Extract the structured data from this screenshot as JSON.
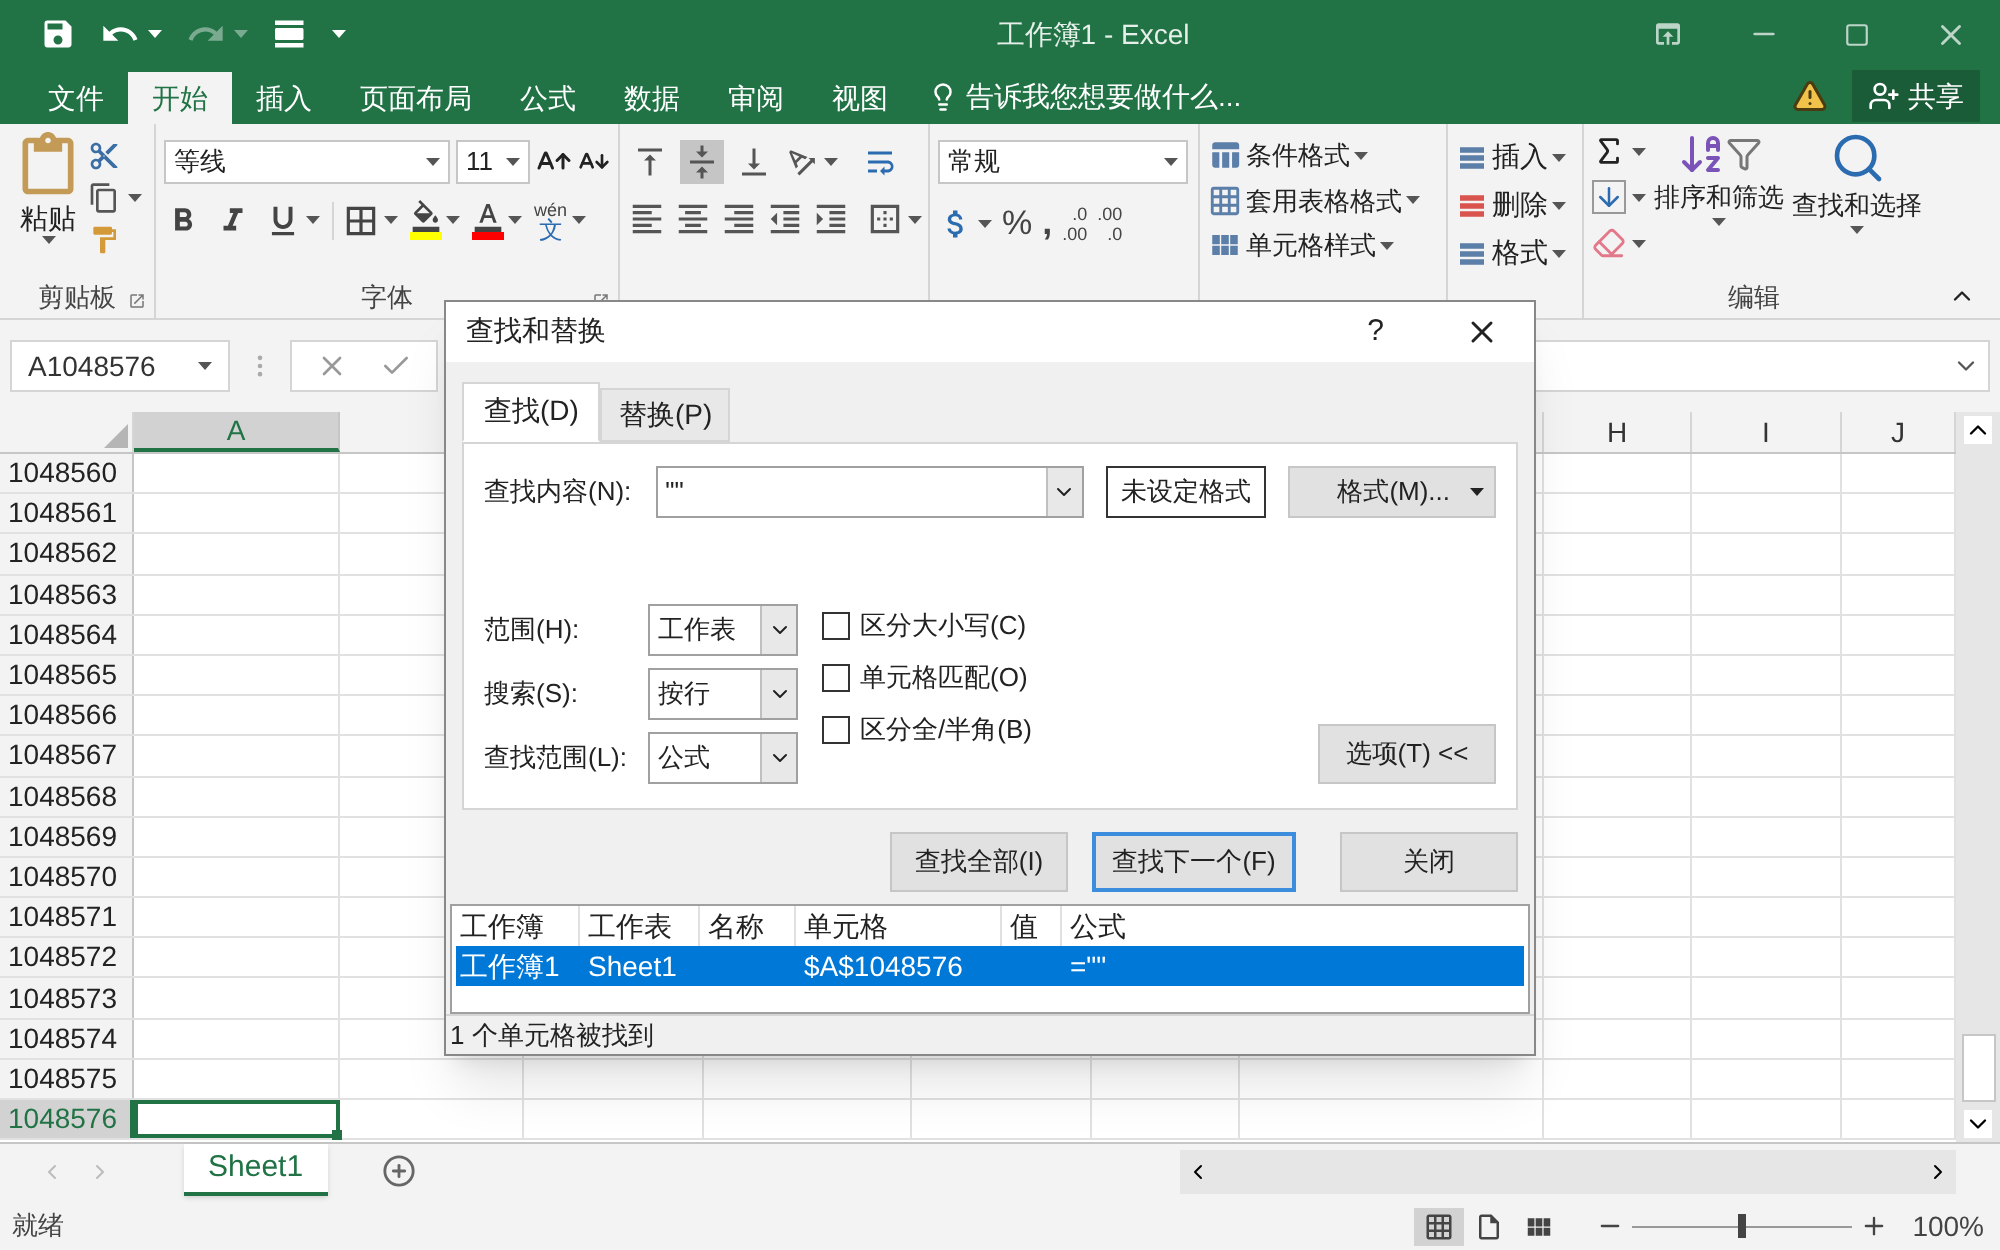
{
  "title_bar": {
    "title": "工作簿1 - Excel"
  },
  "ribbon_tabs": [
    {
      "label": "文件",
      "selected": false
    },
    {
      "label": "开始",
      "selected": true
    },
    {
      "label": "插入",
      "selected": false
    },
    {
      "label": "页面布局",
      "selected": false
    },
    {
      "label": "公式",
      "selected": false
    },
    {
      "label": "数据",
      "selected": false
    },
    {
      "label": "审阅",
      "selected": false
    },
    {
      "label": "视图",
      "selected": false
    }
  ],
  "tell_me": "告诉我您想要做什么...",
  "share_button": "共享",
  "ribbon": {
    "paste_label": "粘贴",
    "clipboard_label": "剪贴板",
    "font_name": "等线",
    "font_size": "11",
    "phonetic": {
      "top": "wén",
      "bottom": "文"
    },
    "font_label": "字体",
    "vertical_align": [
      {
        "selected": false
      },
      {
        "selected": true
      },
      {
        "selected": false
      }
    ],
    "number_format": "常规",
    "percent": "%",
    "comma": ",",
    "decimals": [
      {
        "top": ".0",
        "bottom": ".00"
      },
      {
        "top": ".00",
        "bottom": ".0"
      }
    ],
    "style_commands": [
      "条件格式",
      "套用表格格式",
      "单元格样式"
    ],
    "cell_commands": [
      "插入",
      "删除",
      "格式"
    ],
    "sort_filter": "排序和筛选",
    "find_select": "查找和选择",
    "editing_label": "编辑"
  },
  "name_box": "A1048576",
  "sheet": {
    "columns": [
      {
        "label": "A",
        "selected": true
      },
      {
        "label": "H",
        "selected": false
      },
      {
        "label": "I",
        "selected": false
      },
      {
        "label": "J",
        "selected": false
      }
    ],
    "rows": [
      {
        "label": "1048560",
        "selected": false
      },
      {
        "label": "1048561",
        "selected": false
      },
      {
        "label": "1048562",
        "selected": false
      },
      {
        "label": "1048563",
        "selected": false
      },
      {
        "label": "1048564",
        "selected": false
      },
      {
        "label": "1048565",
        "selected": false
      },
      {
        "label": "1048566",
        "selected": false
      },
      {
        "label": "1048567",
        "selected": false
      },
      {
        "label": "1048568",
        "selected": false
      },
      {
        "label": "1048569",
        "selected": false
      },
      {
        "label": "1048570",
        "selected": false
      },
      {
        "label": "1048571",
        "selected": false
      },
      {
        "label": "1048572",
        "selected": false
      },
      {
        "label": "1048573",
        "selected": false
      },
      {
        "label": "1048574",
        "selected": false
      },
      {
        "label": "1048575",
        "selected": false
      },
      {
        "label": "1048576",
        "selected": true
      }
    ]
  },
  "sheet_tabs": [
    {
      "label": "Sheet1",
      "selected": true
    }
  ],
  "status_bar": {
    "status": "就绪",
    "views": [
      {
        "selected": true
      },
      {
        "selected": false
      },
      {
        "selected": false
      }
    ],
    "zoom": {
      "level": 0.5,
      "reading": "100%"
    }
  },
  "dialog": {
    "title": "查找和替换",
    "help": "?",
    "tabs": [
      {
        "label": "查找(D)",
        "selected": true
      },
      {
        "label": "替换(P)",
        "selected": false
      }
    ],
    "find_label": "查找内容(N):",
    "find_value": "\"\"",
    "no_format": "未设定格式",
    "format_button": "格式(M)...",
    "options": [
      {
        "label": "范围(H):",
        "value": "工作表"
      },
      {
        "label": "搜索(S):",
        "value": "按行"
      },
      {
        "label": "查找范围(L):",
        "value": "公式"
      }
    ],
    "checkboxes": [
      {
        "label": "区分大小写(C)",
        "checked": false
      },
      {
        "label": "单元格匹配(O)",
        "checked": false
      },
      {
        "label": "区分全/半角(B)",
        "checked": false
      }
    ],
    "options_button": "选项(T) <<",
    "buttons": [
      {
        "label": "查找全部(I)",
        "default": false
      },
      {
        "label": "查找下一个(F)",
        "default": true
      },
      {
        "label": "关闭",
        "default": false
      }
    ],
    "results": {
      "columns": [
        "工作簿",
        "工作表",
        "名称",
        "单元格",
        "值",
        "公式"
      ],
      "rows": [
        {
          "workbook": "工作簿1",
          "sheet": "Sheet1",
          "cell": "$A$1048576",
          "formula": "=\"\"",
          "selected": true
        }
      ]
    },
    "status": "1 个单元格被找到"
  }
}
